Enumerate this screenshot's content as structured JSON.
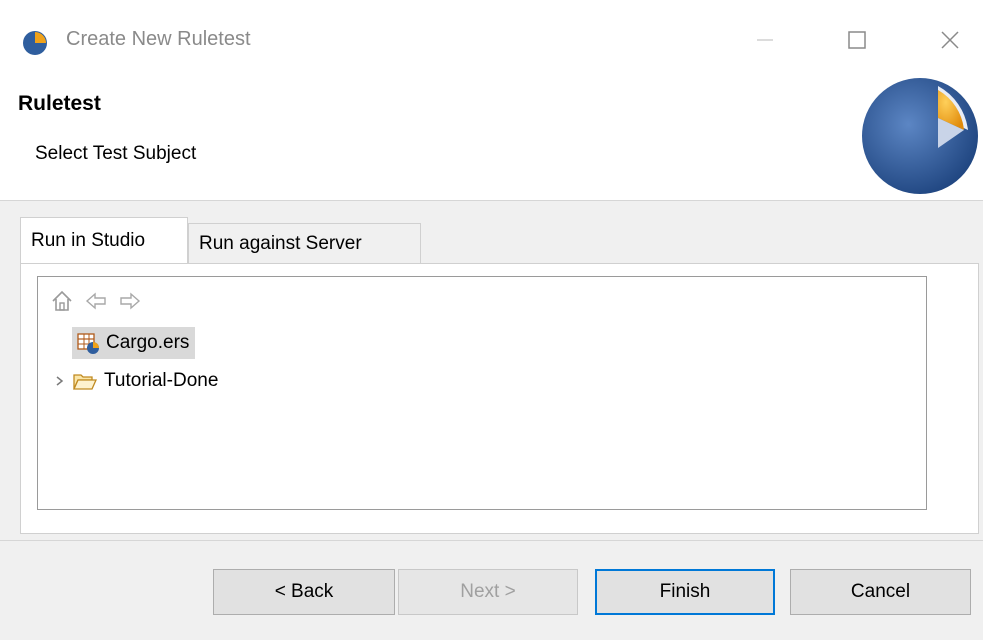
{
  "window": {
    "title": "Create New Ruletest",
    "controls": {
      "minimize_icon": "minimize-icon",
      "maximize_icon": "maximize-icon",
      "close_icon": "close-icon"
    }
  },
  "header": {
    "title": "Ruletest",
    "subtitle": "Select Test Subject"
  },
  "tabs": [
    {
      "label": "Run in Studio",
      "active": true
    },
    {
      "label": "Run against Server",
      "active": false
    }
  ],
  "tree": {
    "nav": [
      "home-icon",
      "back-arrow-icon",
      "forward-arrow-icon"
    ],
    "items": [
      {
        "label": "Cargo.ers",
        "icon": "rulesheet-file-icon",
        "selected": true
      },
      {
        "label": "Tutorial-Done",
        "icon": "folder-icon",
        "expandable": true
      }
    ]
  },
  "buttons": {
    "back": "< Back",
    "next": "Next >",
    "finish": "Finish",
    "cancel": "Cancel"
  },
  "colors": {
    "accent": "#0078d7",
    "logo_blue": "#2f5e9e",
    "logo_orange": "#f0a21a"
  }
}
